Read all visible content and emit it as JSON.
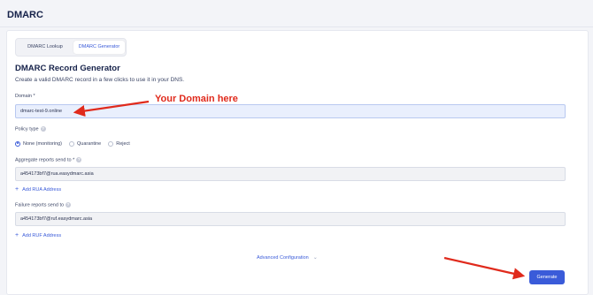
{
  "page": {
    "title": "DMARC"
  },
  "tabs": [
    {
      "label": "DMARC Lookup",
      "active": false
    },
    {
      "label": "DMARC Generator",
      "active": true
    }
  ],
  "generator": {
    "title": "DMARC Record Generator",
    "subtitle": "Create a valid DMARC record in a few clicks to use it in your DNS."
  },
  "domain": {
    "label": "Domain *",
    "value": "dmarc-test-9.online"
  },
  "policy": {
    "label": "Policy type",
    "options": [
      {
        "label": "None (monitoring)",
        "selected": true
      },
      {
        "label": "Quarantine",
        "selected": false
      },
      {
        "label": "Reject",
        "selected": false
      }
    ]
  },
  "rua": {
    "label": "Aggregate reports send to *",
    "value": "a454173bf7@rua.easydmarc.asia",
    "add_label": "Add RUA Address"
  },
  "ruf": {
    "label": "Failure reports send to",
    "value": "a454173bf7@ruf.easydmarc.asia",
    "add_label": "Add RUF Address"
  },
  "advanced": {
    "label": "Advanced Configuration"
  },
  "generate_button": {
    "label": "Generate"
  },
  "annotation": {
    "text": "Your Domain here",
    "color": "#e02a1c"
  },
  "colors": {
    "accent": "#3a5bd9",
    "title": "#16224a"
  }
}
